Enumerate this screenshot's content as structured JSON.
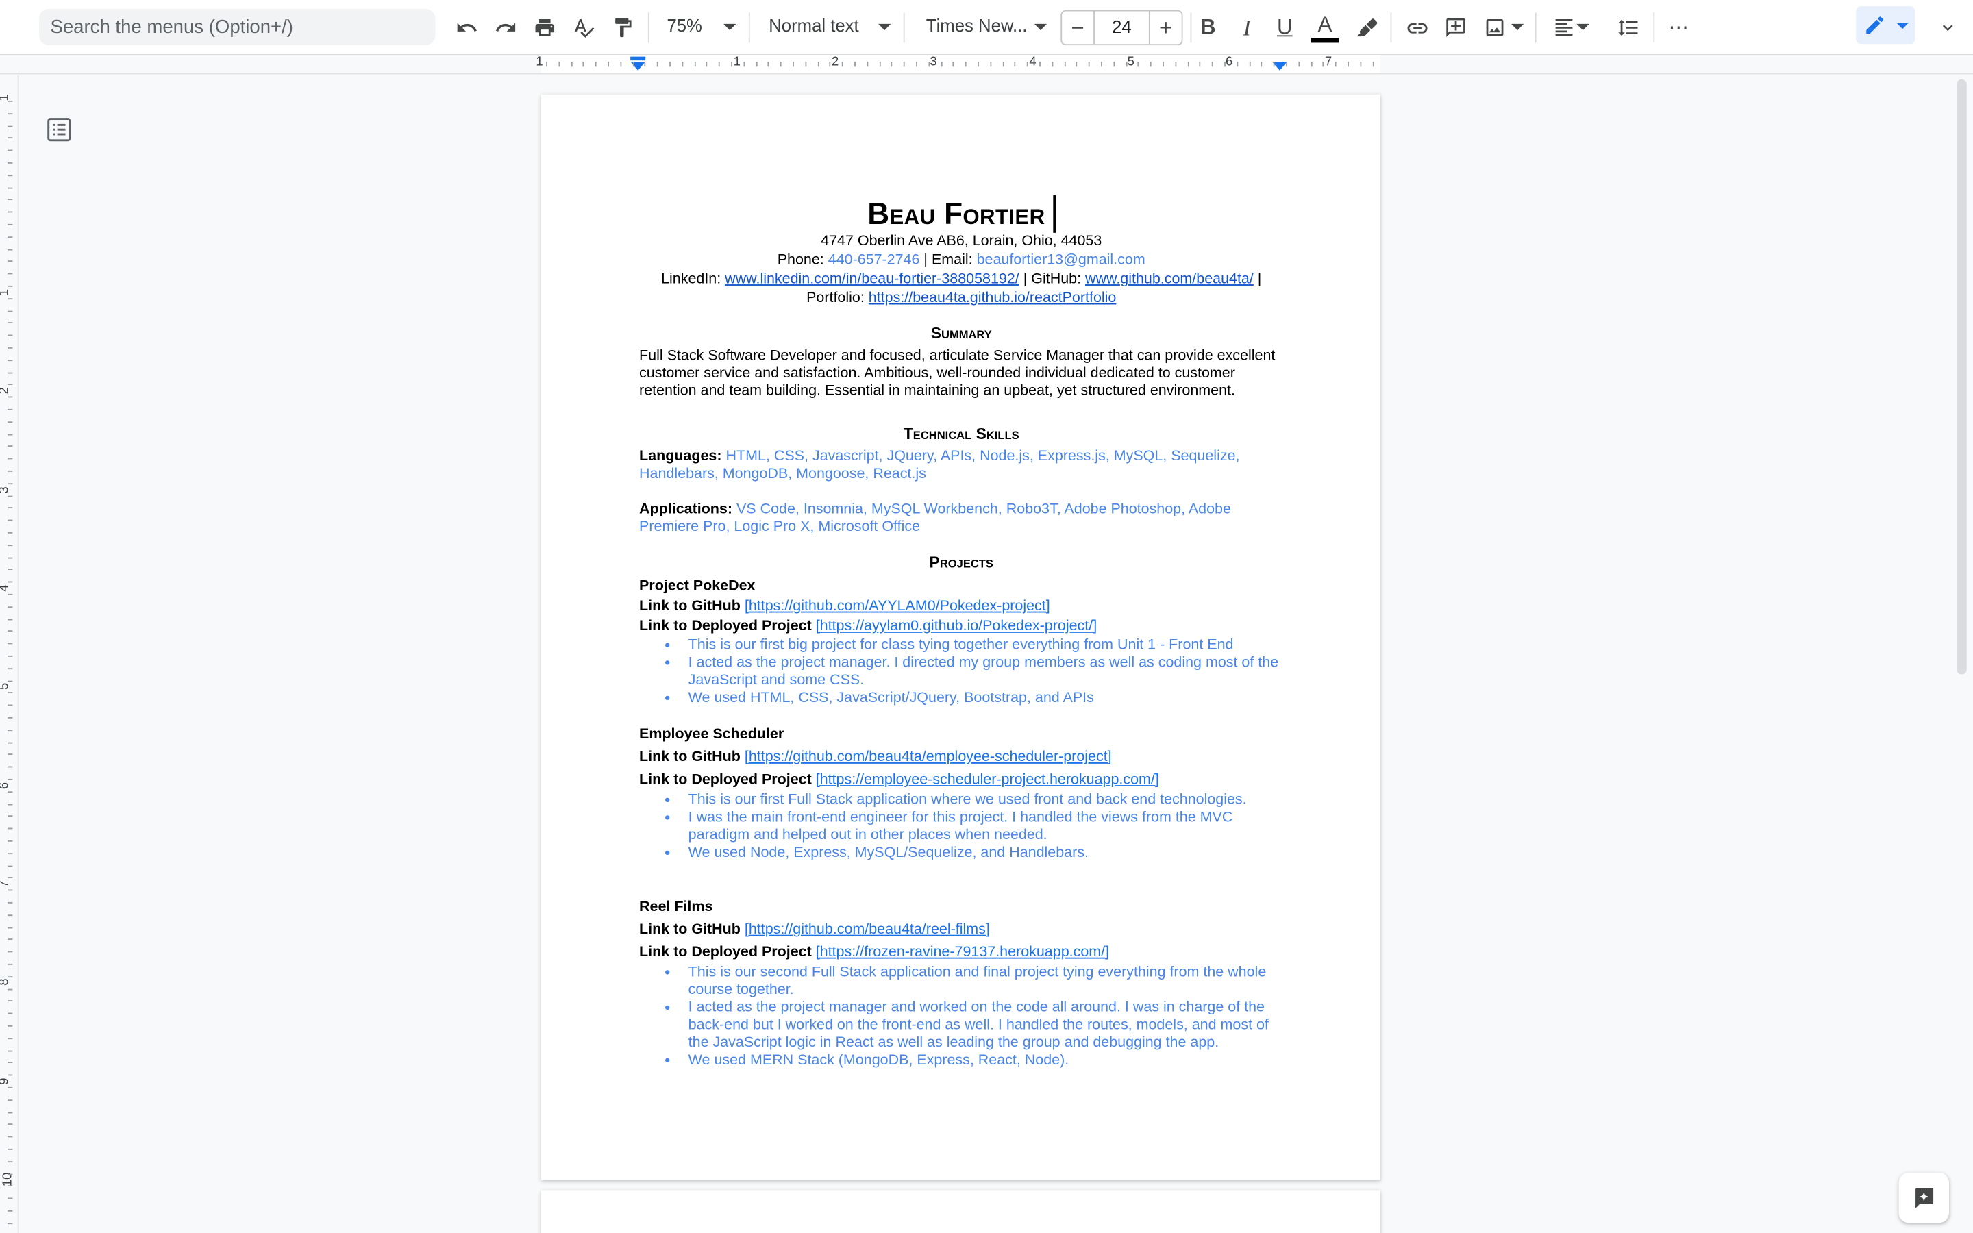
{
  "toolbar": {
    "search_placeholder": "Search the menus (Option+/)",
    "zoom": "75%",
    "style": "Normal text",
    "font": "Times New...",
    "font_size": "24",
    "minus": "−",
    "plus": "+",
    "bold": "B",
    "italic": "I",
    "underline": "U",
    "text_color_letter": "A",
    "more": "⋯"
  },
  "ruler": {
    "h_numbers": [
      "1",
      "1",
      "2",
      "3",
      "4",
      "5",
      "6",
      "7"
    ],
    "v_numbers": [
      "1",
      "1",
      "2",
      "3",
      "4",
      "5",
      "6",
      "7",
      "8",
      "9",
      "10"
    ]
  },
  "resume": {
    "name": "Beau Fortier",
    "address": "4747 Oberlin Ave AB6, Lorain, Ohio, 44053",
    "phone_label": "Phone:",
    "phone": "440-657-2746",
    "email_label": "| Email:",
    "email": "beaufortier13@gmail.com",
    "linkedin_label": "LinkedIn:",
    "linkedin": "www.linkedin.com/in/beau-fortier-388058192/",
    "github_label": "| GitHub:",
    "github": "www.github.com/beau4ta/",
    "pipe": "|",
    "portfolio_label": "Portfolio:",
    "portfolio": "https://beau4ta.github.io/reactPortfolio",
    "summary_heading": "Summary",
    "summary": "Full Stack Software Developer and focused, articulate Service Manager that can provide excellent customer service and satisfaction. Ambitious, well-rounded individual dedicated to customer retention and team building. Essential in maintaining an upbeat, yet structured environment.",
    "skills_heading": "Technical Skills",
    "languages_label": "Languages:",
    "languages": "HTML, CSS, Javascript, JQuery, APIs, Node.js, Express.js, MySQL, Sequelize, Handlebars, MongoDB, Mongoose, React.js",
    "applications_label": "Applications:",
    "applications": "VS Code, Insomnia, MySQL Workbench, Robo3T, Adobe Photoshop, Adobe Premiere Pro, Logic Pro X, Microsoft Office",
    "projects_heading": "Projects",
    "github_link_label": "Link to GitHub",
    "deployed_link_label": "Link to Deployed Project",
    "projects": [
      {
        "title": "Project PokeDex",
        "github": "[https://github.com/AYYLAM0/Pokedex-project]",
        "deployed": "[https://ayylam0.github.io/Pokedex-project/]",
        "bullets": [
          "This is our first big project for class tying together everything from Unit 1 - Front End",
          "I acted as the project manager. I directed my group members as well as coding most of the JavaScript and some CSS.",
          "We used HTML, CSS, JavaScript/JQuery, Bootstrap, and APIs"
        ]
      },
      {
        "title": "Employee Scheduler",
        "github": "[https://github.com/beau4ta/employee-scheduler-project]",
        "deployed": "[https://employee-scheduler-project.herokuapp.com/]",
        "bullets": [
          "This is our first Full Stack application where we used front and back end technologies.",
          "I was the main front-end engineer for this project. I handled the views from the MVC paradigm and helped out in other places when needed.",
          "We used Node, Express, MySQL/Sequelize, and Handlebars."
        ]
      },
      {
        "title": "Reel Films",
        "github": "[https://github.com/beau4ta/reel-films]",
        "deployed": "[https://frozen-ravine-79137.herokuapp.com/]",
        "bullets": [
          "This is our second Full Stack application and final project tying everything from the whole course together.",
          "I acted as the project manager and worked on the code all around. I was in charge of the back-end but I worked on the front-end as well. I handled the routes, models, and most of the JavaScript logic in React as well as leading the group and debugging the app.",
          "We used MERN Stack (MongoDB, Express, React, Node)."
        ]
      }
    ]
  }
}
